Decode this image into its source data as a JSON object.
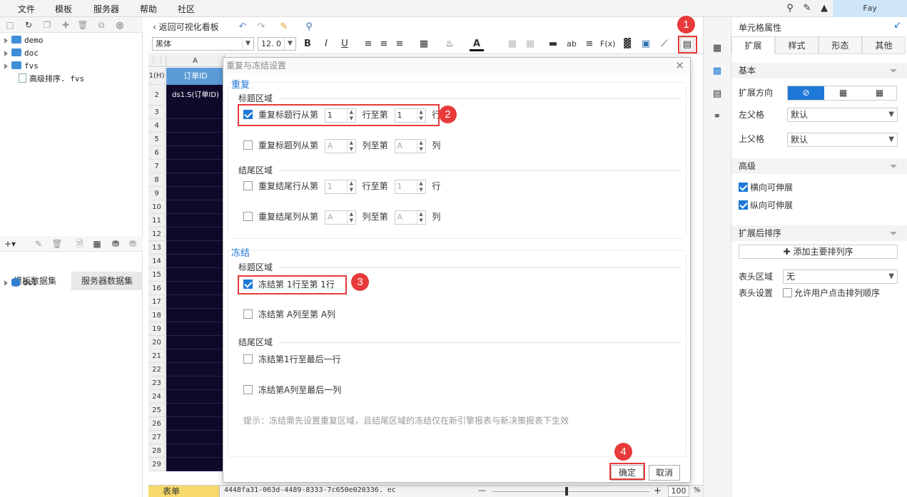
{
  "menu": {
    "items": [
      "文件",
      "模板",
      "服务器",
      "帮助",
      "社区"
    ],
    "user": "Fay"
  },
  "left": {
    "tree": [
      "demo",
      "doc",
      "fvs",
      "高级排序. fvs"
    ],
    "tabs": [
      "模板数据集",
      "服务器数据集"
    ],
    "datasets": [
      "ds1"
    ]
  },
  "toolbar": {
    "back": "返回可视化看板",
    "font": "黑体",
    "font_size": "12. 0",
    "bold": "B",
    "italic": "I",
    "underline": "U",
    "ab": "ab",
    "fx": "F(x)"
  },
  "grid": {
    "col_a": "A",
    "row1_label": "1(H)",
    "header_cell": "订单ID",
    "data_cell": "ds1.S(订单ID)",
    "rows": [
      "2",
      "3",
      "4",
      "5",
      "6",
      "7",
      "8",
      "9",
      "10",
      "11",
      "12",
      "13",
      "14",
      "15",
      "16",
      "17",
      "18",
      "19",
      "20",
      "21",
      "22",
      "23",
      "24",
      "25",
      "26",
      "27",
      "28",
      "29"
    ],
    "sheet_tab": "表单",
    "file_tab": "4448fa31-063d-4489-8333-7c650e020336. ec",
    "zoom": "100",
    "zoom_pct": "%",
    "zoom_minus": "—",
    "zoom_plus": "+"
  },
  "dialog": {
    "title": "重复与冻结设置",
    "repeat_head": "重复",
    "repeat_title_area": "标题区域",
    "repeat_title_row": {
      "a": "重复标题行从第",
      "v1": "1",
      "b": "行至第",
      "v2": "1",
      "c": "行"
    },
    "repeat_title_col": {
      "a": "重复标题列从第",
      "v1": "A",
      "b": "列至第",
      "v2": "A",
      "c": "列"
    },
    "repeat_foot_area": "结尾区域",
    "repeat_foot_row": {
      "a": "重复结尾行从第",
      "v1": "1",
      "b": "行至第",
      "v2": "1",
      "c": "行"
    },
    "repeat_foot_col": {
      "a": "重复结尾列从第",
      "v1": "A",
      "b": "列至第",
      "v2": "A",
      "c": "列"
    },
    "freeze_head": "冻结",
    "freeze_title_area": "标题区域",
    "freeze_row": "冻结第 1行至第 1行",
    "freeze_col": "冻结第 A列至第 A列",
    "freeze_foot_area": "结尾区域",
    "freeze_foot_row": "冻结第1行至最后一行",
    "freeze_foot_col": "冻结第A列至最后一列",
    "tip": "提示：冻结需先设置重复区域，且结尾区域的冻结仅在新引擎报表与新决策报表下生效",
    "ok": "确定",
    "cancel": "取消"
  },
  "badges": [
    "1",
    "2",
    "3",
    "4"
  ],
  "right": {
    "title": "单元格属性",
    "tabs": [
      "扩展",
      "样式",
      "形态",
      "其他"
    ],
    "basic": "基本",
    "expand_dir": "扩展方向",
    "left_parent": "左父格",
    "left_parent_val": "默认",
    "up_parent": "上父格",
    "up_parent_val": "默认",
    "advanced": "高级",
    "h_expand": "横向可伸展",
    "v_expand": "纵向可伸展",
    "sort_section": "扩展后排序",
    "add_sort": "添加主要排列序",
    "header_area": "表头区域",
    "header_area_val": "无",
    "header_setting": "表头设置",
    "allow_sort": "允许用户点击排列顺序"
  },
  "colors": {
    "accent": "#1e78d6",
    "marker": "#e83a3a",
    "dark_cell": "#0f0a2a"
  }
}
